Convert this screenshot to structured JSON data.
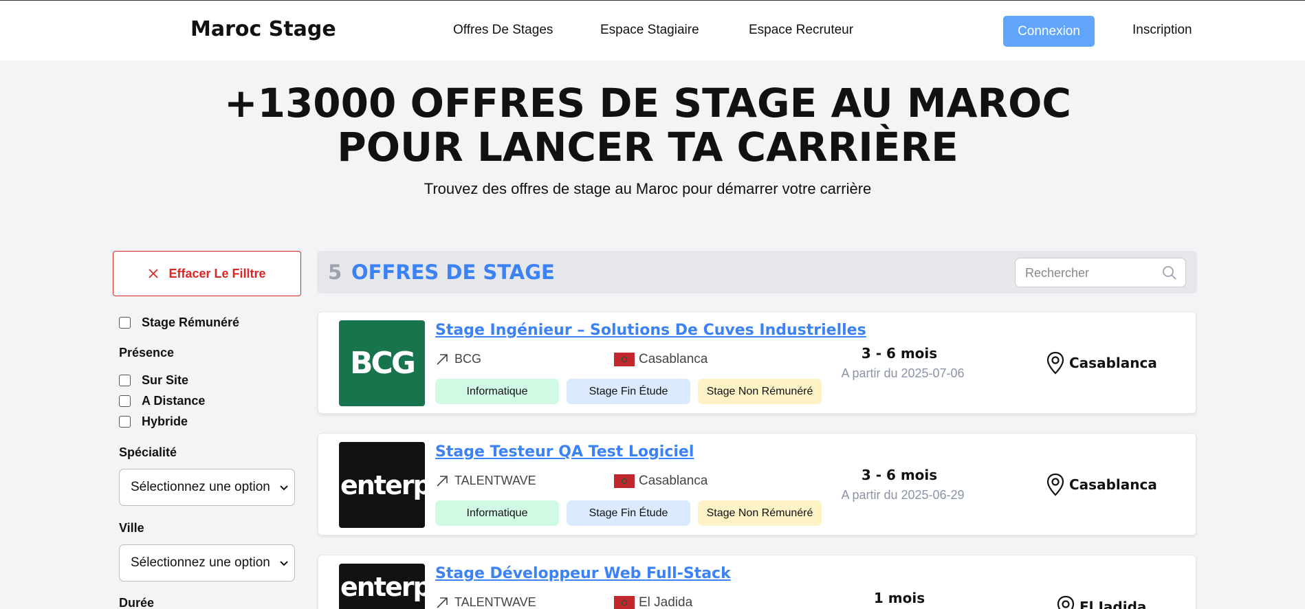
{
  "header": {
    "logo": "Maroc Stage",
    "nav": [
      "Offres De Stages",
      "Espace Stagiaire",
      "Espace Recruteur"
    ],
    "login_label": "Connexion",
    "signup_label": "Inscription",
    "login_color": "#60a5fa"
  },
  "hero": {
    "title_line1": "+13000 OFFRES DE STAGE AU MAROC",
    "title_line2": "POUR LANCER TA CARRIÈRE",
    "subtitle": "Trouvez des offres de stage au Maroc pour démarrer votre carrière"
  },
  "filters": {
    "clear_label": "Effacer Le Filltre",
    "paid_label": "Stage Rémunéré",
    "presence_heading": "Présence",
    "presence_options": [
      "Sur Site",
      "A Distance",
      "Hybride"
    ],
    "specialty_heading": "Spécialité",
    "specialty_value": "Sélectionnez une option",
    "city_heading": "Ville",
    "city_value": "Sélectionnez une option",
    "duration_heading": "Durée"
  },
  "results": {
    "count": "5",
    "label": "OFFRES DE STAGE",
    "search_placeholder": "Rechercher"
  },
  "offers": [
    {
      "title": "Stage Ingénieur – Solutions De Cuves Industrielles",
      "company": "BCG",
      "logo": "BCG",
      "city": "Casablanca",
      "tags": [
        "Informatique",
        "Stage Fin Étude",
        "Stage Non Rémunéré"
      ],
      "duration": "3 - 6 mois",
      "start": "A partir du 2025-07-06",
      "location": "Casablanca"
    },
    {
      "title": "Stage Testeur QA Test Logiciel",
      "company": "TALENTWAVE",
      "logo": "enterprise",
      "city": "Casablanca",
      "tags": [
        "Informatique",
        "Stage Fin Étude",
        "Stage Non Rémunéré"
      ],
      "duration": "3 - 6 mois",
      "start": "A partir du 2025-06-29",
      "location": "Casablanca"
    },
    {
      "title": "Stage Développeur Web Full-Stack",
      "company": "TALENTWAVE",
      "logo": "enterprise",
      "city": "El Jadida",
      "duration": "1 mois",
      "location": "El Jadida"
    }
  ],
  "colors": {
    "accent": "#3b82f6",
    "danger": "#dc2626",
    "background": "#f3f4f6"
  }
}
